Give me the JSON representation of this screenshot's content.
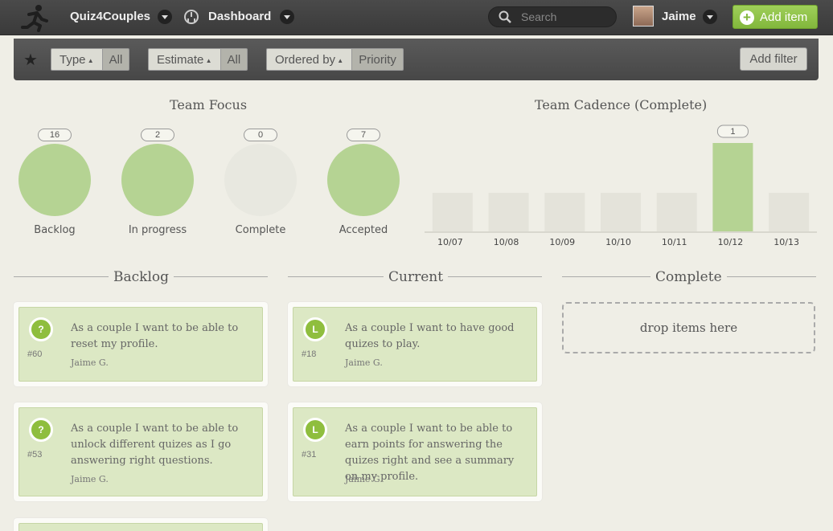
{
  "header": {
    "project": "Quiz4Couples",
    "view": "Dashboard",
    "search_placeholder": "Search",
    "user": "Jaime",
    "add_item_label": "Add item",
    "brand_color": "#8bc34a"
  },
  "filters": {
    "items": [
      {
        "key": "Type",
        "value": "All"
      },
      {
        "key": "Estimate",
        "value": "All"
      },
      {
        "key": "Ordered by",
        "value": "Priority"
      }
    ],
    "add_filter_label": "Add filter"
  },
  "team_focus": {
    "title": "Team Focus",
    "items": [
      {
        "label": "Backlog",
        "count": "16",
        "color": "#b5d393"
      },
      {
        "label": "In progress",
        "count": "2",
        "color": "#b5d393"
      },
      {
        "label": "Complete",
        "count": "0",
        "color": "#e8e8e0"
      },
      {
        "label": "Accepted",
        "count": "7",
        "color": "#b5d393"
      }
    ]
  },
  "chart_data": {
    "type": "bar",
    "title": "Team Cadence (Complete)",
    "categories": [
      "10/07",
      "10/08",
      "10/09",
      "10/10",
      "10/11",
      "10/12",
      "10/13"
    ],
    "values": [
      0,
      0,
      0,
      0,
      0,
      1,
      0
    ],
    "data_labels": {
      "5": "1"
    },
    "ylim": [
      0,
      1
    ],
    "bar_color": "#b5d393",
    "empty_color": "#e4e3da"
  },
  "columns": {
    "backlog": {
      "title": "Backlog",
      "cards": [
        {
          "badge": "?",
          "id": "#60",
          "text": "As a couple I want to be able to reset my profile.",
          "owner": "Jaime G."
        },
        {
          "badge": "?",
          "id": "#53",
          "text": "As a couple I want to be able to unlock different quizes as I go answering right questions.",
          "owner": "Jaime G."
        }
      ]
    },
    "current": {
      "title": "Current",
      "cards": [
        {
          "badge": "L",
          "id": "#18",
          "text": "As a couple I want to have good quizes to play.",
          "owner": "Jaime G."
        },
        {
          "badge": "L",
          "id": "#31",
          "text": "As a couple I want to be able to earn points for answering the quizes right and see a summary on my profile.",
          "owner": "Jaime G."
        }
      ]
    },
    "complete": {
      "title": "Complete",
      "drop_text": "drop items here"
    }
  }
}
